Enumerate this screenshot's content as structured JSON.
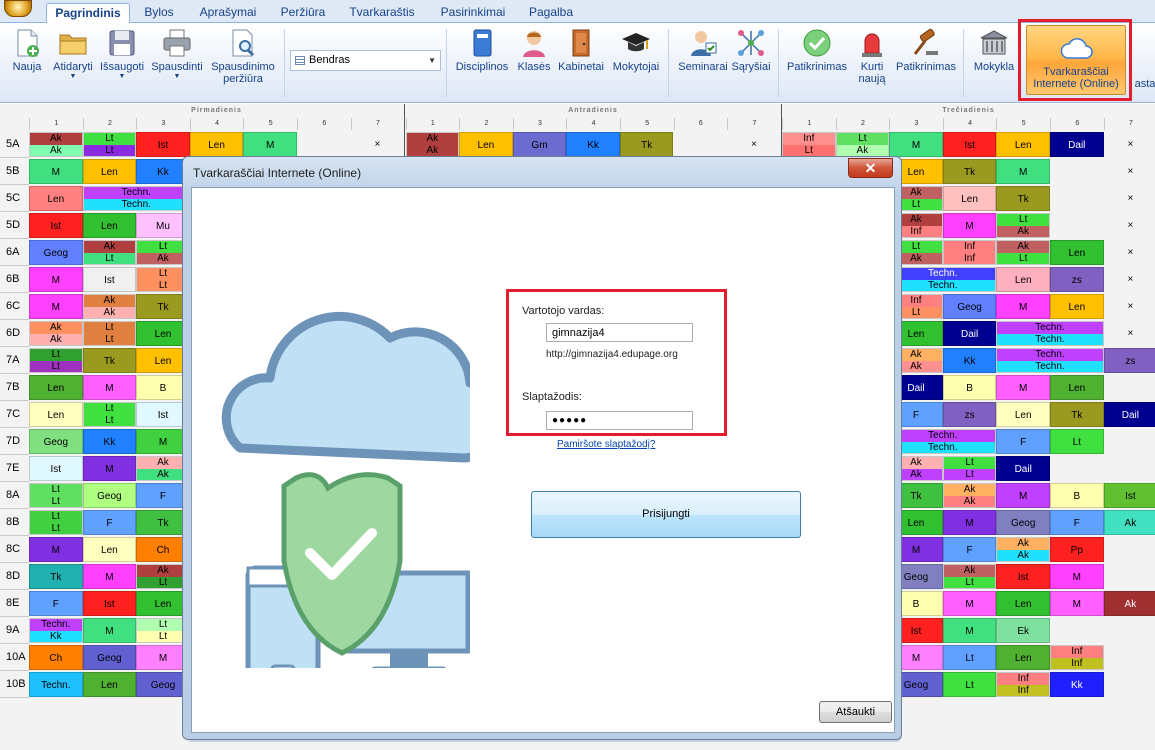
{
  "tabs": [
    "Pagrindinis",
    "Bylos",
    "Aprašymai",
    "Peržiūra",
    "Tvarkaraštis",
    "Pasirinkimai",
    "Pagalba"
  ],
  "active_tab": "Pagrindinis",
  "ribbon": {
    "new": "Nauja",
    "open": "Atidaryti",
    "save": "Išsaugoti",
    "print": "Spausdinti",
    "print_preview": "Spausdinimo peržiūra",
    "view_select": "Bendras",
    "subjects": "Disciplinos",
    "classes": "Klasės",
    "rooms": "Kabinetai",
    "teachers": "Mokytojai",
    "seminars": "Seminarai",
    "relations": "Sąryšiai",
    "check": "Patikrinimas",
    "create_new": "Kurti naują",
    "check2": "Patikrinimas",
    "school": "Mokykla",
    "online": "Tvarkaraščiai Internete (Online)",
    "cut_text": "asta"
  },
  "days": [
    "Pirmadienis",
    "Antradienis",
    "Trečiadienis"
  ],
  "periods": [
    "1",
    "2",
    "3",
    "4",
    "5",
    "6",
    "7"
  ],
  "timetable": {
    "rows": [
      "5A",
      "5B",
      "5C",
      "5D",
      "6A",
      "6B",
      "6C",
      "6D",
      "7A",
      "7B",
      "7C",
      "7D",
      "7E",
      "8A",
      "8B",
      "8C",
      "8D",
      "8E",
      "9A",
      "10A",
      "10B"
    ],
    "cells": [
      {
        "r": 0,
        "c": 0,
        "t": "Ak",
        "b": "Ak",
        "ct": "#b04040",
        "cb": "#80ffb0"
      },
      {
        "r": 0,
        "c": 1,
        "t": "Lt",
        "b": "Lt",
        "ct": "#40e040",
        "cb": "#8a2be2"
      },
      {
        "r": 0,
        "c": 2,
        "t": "Ist",
        "ct": "#ff2020"
      },
      {
        "r": 0,
        "c": 3,
        "t": "Len",
        "ct": "#ffc000"
      },
      {
        "r": 0,
        "c": 4,
        "t": "M",
        "ct": "#40e080"
      },
      {
        "r": 0,
        "c": 6,
        "t": "×",
        "ct": "#f3f3f3"
      },
      {
        "r": 0,
        "c": 7,
        "t": "Ak",
        "b": "Ak",
        "ct": "#b04040",
        "cb": "#b04040"
      },
      {
        "r": 0,
        "c": 8,
        "t": "Len",
        "ct": "#ffc000"
      },
      {
        "r": 0,
        "c": 9,
        "t": "Gm",
        "ct": "#6b6bd0"
      },
      {
        "r": 0,
        "c": 10,
        "t": "Kk",
        "ct": "#2080ff"
      },
      {
        "r": 0,
        "c": 11,
        "t": "Tk",
        "ct": "#9a9a20"
      },
      {
        "r": 0,
        "c": 13,
        "t": "×",
        "ct": "#f3f3f3"
      },
      {
        "r": 0,
        "c": 14,
        "t": "Inf",
        "b": "Lt",
        "ct": "#ff9090",
        "cb": "#ff7070"
      },
      {
        "r": 0,
        "c": 15,
        "t": "Lt",
        "b": "Ak",
        "ct": "#60e060",
        "cb": "#b0ffb0"
      },
      {
        "r": 0,
        "c": 16,
        "t": "M",
        "ct": "#40e080"
      },
      {
        "r": 0,
        "c": 17,
        "t": "Ist",
        "ct": "#ff2020"
      },
      {
        "r": 0,
        "c": 18,
        "t": "Len",
        "ct": "#ffc000"
      },
      {
        "r": 0,
        "c": 19,
        "t": "Dail",
        "ct": "#000090"
      },
      {
        "r": 0,
        "c": 20,
        "t": "×",
        "ct": "#f3f3f3"
      },
      {
        "r": 1,
        "c": 0,
        "t": "M",
        "ct": "#40e080"
      },
      {
        "r": 1,
        "c": 1,
        "t": "Len",
        "ct": "#ffc000"
      },
      {
        "r": 1,
        "c": 2,
        "t": "Kk",
        "ct": "#2080ff"
      },
      {
        "r": 1,
        "c": 16,
        "t": "Len",
        "ct": "#ffc000"
      },
      {
        "r": 1,
        "c": 17,
        "t": "Tk",
        "ct": "#9a9a20"
      },
      {
        "r": 1,
        "c": 18,
        "t": "M",
        "ct": "#40e080"
      },
      {
        "r": 1,
        "c": 20,
        "t": "×",
        "ct": "#f3f3f3"
      },
      {
        "r": 2,
        "c": 0,
        "t": "Len",
        "ct": "#ff8080"
      },
      {
        "r": 2,
        "c": 1,
        "t": "Techn.",
        "b": "Techn.",
        "ct": "#c040ff",
        "cb": "#20e0ff",
        "span": 2
      },
      {
        "r": 2,
        "c": 16,
        "t": "Ak",
        "b": "Lt",
        "ct": "#c06060",
        "cb": "#40e040"
      },
      {
        "r": 2,
        "c": 17,
        "t": "Len",
        "ct": "#ffc0c0"
      },
      {
        "r": 2,
        "c": 18,
        "t": "Tk",
        "ct": "#9a9a20"
      },
      {
        "r": 2,
        "c": 20,
        "t": "×",
        "ct": "#f3f3f3"
      },
      {
        "r": 3,
        "c": 0,
        "t": "Ist",
        "ct": "#ff2020"
      },
      {
        "r": 3,
        "c": 1,
        "t": "Len",
        "ct": "#30c030"
      },
      {
        "r": 3,
        "c": 2,
        "t": "Mu",
        "ct": "#ffc0ff"
      },
      {
        "r": 3,
        "c": 16,
        "t": "Ak",
        "b": "Inf",
        "ct": "#b04040",
        "cb": "#ff8080"
      },
      {
        "r": 3,
        "c": 17,
        "t": "M",
        "ct": "#ff40ff"
      },
      {
        "r": 3,
        "c": 18,
        "t": "Lt",
        "b": "Ak",
        "ct": "#40e040",
        "cb": "#c06060"
      },
      {
        "r": 3,
        "c": 20,
        "t": "×",
        "ct": "#f3f3f3"
      },
      {
        "r": 4,
        "c": 0,
        "t": "Geog",
        "ct": "#6080ff"
      },
      {
        "r": 4,
        "c": 1,
        "t": "Ak",
        "b": "Lt",
        "ct": "#b04040",
        "cb": "#40e080"
      },
      {
        "r": 4,
        "c": 2,
        "t": "Lt",
        "b": "Ak",
        "ct": "#40e040",
        "cb": "#c06060"
      },
      {
        "r": 4,
        "c": 16,
        "t": "Lt",
        "b": "Ak",
        "ct": "#40e040",
        "cb": "#c06060"
      },
      {
        "r": 4,
        "c": 17,
        "t": "Inf",
        "b": "Inf",
        "ct": "#ff8080",
        "cb": "#ff8080"
      },
      {
        "r": 4,
        "c": 18,
        "t": "Ak",
        "b": "Lt",
        "ct": "#c06060",
        "cb": "#40e040"
      },
      {
        "r": 4,
        "c": 19,
        "t": "Len",
        "ct": "#30c030"
      },
      {
        "r": 4,
        "c": 20,
        "t": "×",
        "ct": "#f3f3f3"
      },
      {
        "r": 5,
        "c": 0,
        "t": "M",
        "ct": "#ff40ff"
      },
      {
        "r": 5,
        "c": 1,
        "t": "Ist",
        "ct": "#f0f0f0"
      },
      {
        "r": 5,
        "c": 2,
        "t": "Lt",
        "b": "Lt",
        "ct": "#ff9060",
        "cb": "#ff9060"
      },
      {
        "r": 5,
        "c": 16,
        "t": "Techn.",
        "b": "Techn.",
        "ct": "#4040ff",
        "cb": "#20e0ff",
        "span": 2
      },
      {
        "r": 5,
        "c": 18,
        "t": "Len",
        "ct": "#ffb0c0"
      },
      {
        "r": 5,
        "c": 19,
        "t": "zs",
        "ct": "#8060c0"
      },
      {
        "r": 5,
        "c": 20,
        "t": "×",
        "ct": "#f3f3f3"
      },
      {
        "r": 6,
        "c": 0,
        "t": "M",
        "ct": "#ff40ff"
      },
      {
        "r": 6,
        "c": 1,
        "t": "Ak",
        "b": "Ak",
        "ct": "#e08040",
        "cb": "#ffb0b0"
      },
      {
        "r": 6,
        "c": 2,
        "t": "Tk",
        "ct": "#9a9a20"
      },
      {
        "r": 6,
        "c": 16,
        "t": "Inf",
        "b": "Lt",
        "ct": "#ff8080",
        "cb": "#ff9060"
      },
      {
        "r": 6,
        "c": 17,
        "t": "Geog",
        "ct": "#6080ff"
      },
      {
        "r": 6,
        "c": 18,
        "t": "M",
        "ct": "#ff40ff"
      },
      {
        "r": 6,
        "c": 19,
        "t": "Len",
        "ct": "#ffc000"
      },
      {
        "r": 6,
        "c": 20,
        "t": "×",
        "ct": "#f3f3f3"
      },
      {
        "r": 7,
        "c": 0,
        "t": "Ak",
        "b": "Ak",
        "ct": "#ff9060",
        "cb": "#ffb0b0"
      },
      {
        "r": 7,
        "c": 1,
        "t": "Lt",
        "b": "Lt",
        "ct": "#e08040",
        "cb": "#e08040"
      },
      {
        "r": 7,
        "c": 2,
        "t": "Len",
        "ct": "#30c030"
      },
      {
        "r": 7,
        "c": 16,
        "t": "Len",
        "ct": "#30c030"
      },
      {
        "r": 7,
        "c": 17,
        "t": "Dail",
        "ct": "#000090"
      },
      {
        "r": 7,
        "c": 18,
        "t": "Techn.",
        "b": "Techn.",
        "ct": "#c040ff",
        "cb": "#20e0ff",
        "span": 2
      },
      {
        "r": 7,
        "c": 20,
        "t": "×",
        "ct": "#f3f3f3"
      },
      {
        "r": 8,
        "c": 0,
        "t": "Lt",
        "b": "Lt",
        "ct": "#30a030",
        "cb": "#a030c0"
      },
      {
        "r": 8,
        "c": 1,
        "t": "Tk",
        "ct": "#9a9a20"
      },
      {
        "r": 8,
        "c": 2,
        "t": "Len",
        "ct": "#ffc000"
      },
      {
        "r": 8,
        "c": 16,
        "t": "Ak",
        "b": "Ak",
        "ct": "#ffb060",
        "cb": "#ff9090"
      },
      {
        "r": 8,
        "c": 17,
        "t": "Kk",
        "ct": "#2080ff"
      },
      {
        "r": 8,
        "c": 18,
        "t": "Techn.",
        "b": "Techn.",
        "ct": "#c040ff",
        "cb": "#20e0ff",
        "span": 2
      },
      {
        "r": 8,
        "c": 20,
        "t": "zs",
        "ct": "#8060c0"
      },
      {
        "r": 9,
        "c": 0,
        "t": "Len",
        "ct": "#50b030"
      },
      {
        "r": 9,
        "c": 1,
        "t": "M",
        "ct": "#ff60ff"
      },
      {
        "r": 9,
        "c": 2,
        "t": "B",
        "ct": "#ffffb0"
      },
      {
        "r": 9,
        "c": 16,
        "t": "Dail",
        "ct": "#000090"
      },
      {
        "r": 9,
        "c": 17,
        "t": "B",
        "ct": "#ffffb0"
      },
      {
        "r": 9,
        "c": 18,
        "t": "M",
        "ct": "#ff60ff"
      },
      {
        "r": 9,
        "c": 19,
        "t": "Len",
        "ct": "#50b030"
      },
      {
        "r": 10,
        "c": 0,
        "t": "Len",
        "ct": "#ffffc0"
      },
      {
        "r": 10,
        "c": 1,
        "t": "Lt",
        "b": "Lt",
        "ct": "#40e040",
        "cb": "#40e040"
      },
      {
        "r": 10,
        "c": 2,
        "t": "Ist",
        "ct": "#e0f8ff"
      },
      {
        "r": 10,
        "c": 16,
        "t": "F",
        "ct": "#60a0ff"
      },
      {
        "r": 10,
        "c": 17,
        "t": "zs",
        "ct": "#8060c0"
      },
      {
        "r": 10,
        "c": 18,
        "t": "Len",
        "ct": "#ffffc0"
      },
      {
        "r": 10,
        "c": 19,
        "t": "Tk",
        "ct": "#9a9a20"
      },
      {
        "r": 10,
        "c": 20,
        "t": "Dail",
        "ct": "#000090"
      },
      {
        "r": 11,
        "c": 0,
        "t": "Geog",
        "ct": "#80e080"
      },
      {
        "r": 11,
        "c": 1,
        "t": "Kk",
        "ct": "#2080ff"
      },
      {
        "r": 11,
        "c": 2,
        "t": "M",
        "ct": "#40d040"
      },
      {
        "r": 11,
        "c": 16,
        "t": "Techn.",
        "b": "Techn.",
        "ct": "#c040ff",
        "cb": "#20e0ff",
        "span": 2
      },
      {
        "r": 11,
        "c": 18,
        "t": "F",
        "ct": "#60a0ff"
      },
      {
        "r": 11,
        "c": 19,
        "t": "Lt",
        "ct": "#40e040"
      },
      {
        "r": 12,
        "c": 0,
        "t": "Ist",
        "ct": "#e0f8ff"
      },
      {
        "r": 12,
        "c": 1,
        "t": "M",
        "ct": "#8030e0"
      },
      {
        "r": 12,
        "c": 2,
        "t": "Ak",
        "b": "Ak",
        "ct": "#ffb0b0",
        "cb": "#40e080"
      },
      {
        "r": 12,
        "c": 16,
        "t": "Ak",
        "b": "Ak",
        "ct": "#ffb0b0",
        "cb": "#c040ff"
      },
      {
        "r": 12,
        "c": 17,
        "t": "Lt",
        "b": "Lt",
        "ct": "#40e040",
        "cb": "#c040ff"
      },
      {
        "r": 12,
        "c": 18,
        "t": "Dail",
        "ct": "#000090"
      },
      {
        "r": 13,
        "c": 0,
        "t": "Lt",
        "b": "Lt",
        "ct": "#60e060",
        "cb": "#60e060"
      },
      {
        "r": 13,
        "c": 1,
        "t": "Geog",
        "ct": "#b0ff80"
      },
      {
        "r": 13,
        "c": 2,
        "t": "F",
        "ct": "#60a0ff"
      },
      {
        "r": 13,
        "c": 16,
        "t": "Tk",
        "ct": "#40c040"
      },
      {
        "r": 13,
        "c": 17,
        "t": "Ak",
        "b": "Ak",
        "ct": "#ffb060",
        "cb": "#ff8080"
      },
      {
        "r": 13,
        "c": 18,
        "t": "M",
        "ct": "#c040ff"
      },
      {
        "r": 13,
        "c": 19,
        "t": "B",
        "ct": "#ffffb0"
      },
      {
        "r": 13,
        "c": 20,
        "t": "Ist",
        "ct": "#60c030"
      },
      {
        "r": 14,
        "c": 0,
        "t": "Lt",
        "b": "Lt",
        "ct": "#40d040",
        "cb": "#40d040"
      },
      {
        "r": 14,
        "c": 1,
        "t": "F",
        "ct": "#60a0ff"
      },
      {
        "r": 14,
        "c": 2,
        "t": "Tk",
        "ct": "#40c040"
      },
      {
        "r": 14,
        "c": 16,
        "t": "Len",
        "ct": "#30c030"
      },
      {
        "r": 14,
        "c": 17,
        "t": "M",
        "ct": "#8030e0"
      },
      {
        "r": 14,
        "c": 18,
        "t": "Geog",
        "ct": "#8080c0"
      },
      {
        "r": 14,
        "c": 19,
        "t": "F",
        "ct": "#60a0ff"
      },
      {
        "r": 14,
        "c": 20,
        "t": "Ak",
        "ct": "#40e0c0"
      },
      {
        "r": 15,
        "c": 0,
        "t": "M",
        "ct": "#8030e0"
      },
      {
        "r": 15,
        "c": 1,
        "t": "Len",
        "ct": "#ffffc0"
      },
      {
        "r": 15,
        "c": 2,
        "t": "Ch",
        "ct": "#ff8000"
      },
      {
        "r": 15,
        "c": 16,
        "t": "M",
        "ct": "#8030e0"
      },
      {
        "r": 15,
        "c": 17,
        "t": "F",
        "ct": "#60a0ff"
      },
      {
        "r": 15,
        "c": 18,
        "t": "Ak",
        "b": "Ak",
        "ct": "#ffb060",
        "cb": "#20e0ff"
      },
      {
        "r": 15,
        "c": 19,
        "t": "Pp",
        "ct": "#ff2020"
      },
      {
        "r": 16,
        "c": 0,
        "t": "Tk",
        "ct": "#20b0b0"
      },
      {
        "r": 16,
        "c": 1,
        "t": "M",
        "ct": "#ff40ff"
      },
      {
        "r": 16,
        "c": 2,
        "t": "Ak",
        "b": "Lt",
        "ct": "#b04040",
        "cb": "#30a030"
      },
      {
        "r": 16,
        "c": 16,
        "t": "Geog",
        "ct": "#8080c0"
      },
      {
        "r": 16,
        "c": 17,
        "t": "Ak",
        "b": "Lt",
        "ct": "#c06060",
        "cb": "#40e040"
      },
      {
        "r": 16,
        "c": 18,
        "t": "Ist",
        "ct": "#ff2020"
      },
      {
        "r": 16,
        "c": 19,
        "t": "M",
        "ct": "#ff40ff"
      },
      {
        "r": 17,
        "c": 0,
        "t": "F",
        "ct": "#60a0ff"
      },
      {
        "r": 17,
        "c": 1,
        "t": "Ist",
        "ct": "#ff2020"
      },
      {
        "r": 17,
        "c": 2,
        "t": "Len",
        "ct": "#30c030"
      },
      {
        "r": 17,
        "c": 16,
        "t": "B",
        "ct": "#ffffb0"
      },
      {
        "r": 17,
        "c": 17,
        "t": "M",
        "ct": "#ff60ff"
      },
      {
        "r": 17,
        "c": 18,
        "t": "Len",
        "ct": "#30c030"
      },
      {
        "r": 17,
        "c": 19,
        "t": "M",
        "ct": "#ff60ff"
      },
      {
        "r": 17,
        "c": 20,
        "t": "Ak",
        "ct": "#a03030"
      },
      {
        "r": 18,
        "c": 0,
        "t": "Techn.",
        "b": "Kk",
        "ct": "#c040ff",
        "cb": "#20e0ff"
      },
      {
        "r": 18,
        "c": 1,
        "t": "M",
        "ct": "#40e080"
      },
      {
        "r": 18,
        "c": 2,
        "t": "Lt",
        "b": "Lt",
        "ct": "#b0ffb0",
        "cb": "#ffffb0"
      },
      {
        "r": 18,
        "c": 16,
        "t": "Ist",
        "ct": "#ff2020"
      },
      {
        "r": 18,
        "c": 17,
        "t": "M",
        "ct": "#40e080"
      },
      {
        "r": 18,
        "c": 18,
        "t": "Ek",
        "ct": "#80e0a0"
      },
      {
        "r": 19,
        "c": 0,
        "t": "Ch",
        "ct": "#ff8000"
      },
      {
        "r": 19,
        "c": 1,
        "t": "Geog",
        "ct": "#6060d0"
      },
      {
        "r": 19,
        "c": 2,
        "t": "M",
        "ct": "#ff80ff"
      },
      {
        "r": 19,
        "c": 16,
        "t": "M",
        "ct": "#ff80ff"
      },
      {
        "r": 19,
        "c": 17,
        "t": "Lt",
        "ct": "#60a0ff"
      },
      {
        "r": 19,
        "c": 18,
        "t": "Len",
        "ct": "#50b030"
      },
      {
        "r": 19,
        "c": 19,
        "t": "Inf",
        "b": "Inf",
        "ct": "#ff8080",
        "cb": "#c0c020"
      },
      {
        "r": 20,
        "c": 0,
        "t": "Techn.",
        "ct": "#20c0ff"
      },
      {
        "r": 20,
        "c": 1,
        "t": "Len",
        "ct": "#50b030"
      },
      {
        "r": 20,
        "c": 2,
        "t": "Geog",
        "ct": "#6060d0"
      },
      {
        "r": 20,
        "c": 16,
        "t": "Geog",
        "ct": "#6060d0"
      },
      {
        "r": 20,
        "c": 17,
        "t": "Lt",
        "ct": "#40e040"
      },
      {
        "r": 20,
        "c": 18,
        "t": "Inf",
        "b": "Inf",
        "ct": "#ff8080",
        "cb": "#c0c020"
      },
      {
        "r": 20,
        "c": 19,
        "t": "Kk",
        "ct": "#2020ff"
      }
    ]
  },
  "dialog": {
    "title": "Tvarkaraščiai Internete (Online)",
    "close_symbol": "✕",
    "username_label": "Vartotojo vardas:",
    "username_value": "gimnazija4",
    "url_text": "http://gimnazija4.edupage.org",
    "password_label": "Slaptažodis:",
    "password_value": "●●●●●",
    "forgot_link": "Pamiršote slaptažodį?",
    "login_button": "Prisijungti",
    "cancel_button": "Atšaukti"
  },
  "colors": {
    "accent_highlight": "#e21e2e",
    "online_button": "#ffb84a"
  }
}
